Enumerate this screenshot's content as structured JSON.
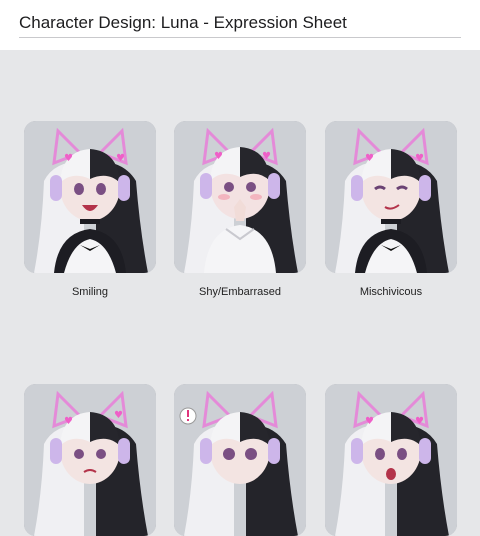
{
  "page": {
    "title": "Character Design: Luna - Expression Sheet"
  },
  "expressions": [
    {
      "label": "Smiling"
    },
    {
      "label": "Shy/Embarrased"
    },
    {
      "label": "Mischivicous"
    },
    {
      "label": ""
    },
    {
      "label": ""
    },
    {
      "label": ""
    }
  ],
  "colors": {
    "background": "#e6e7e9",
    "card": "#cfd1d5",
    "hair_white": "#f1f1f3",
    "hair_black": "#1f1f25",
    "accent_pink": "#e07ad0",
    "headphones": "#c9b3e6"
  }
}
